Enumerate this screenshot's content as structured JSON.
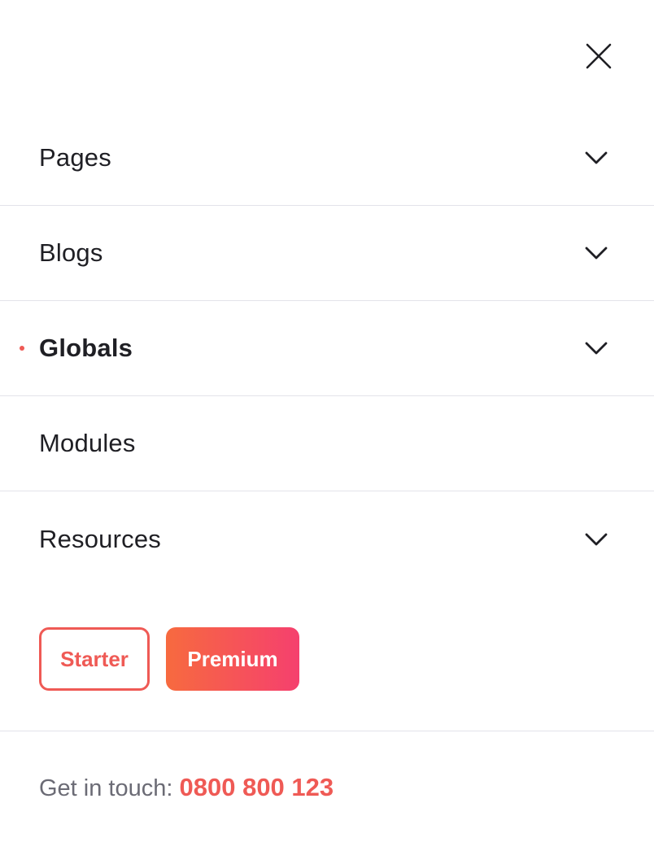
{
  "nav": {
    "items": [
      {
        "label": "Pages",
        "has_dropdown": true,
        "active": false
      },
      {
        "label": "Blogs",
        "has_dropdown": true,
        "active": false
      },
      {
        "label": "Globals",
        "has_dropdown": true,
        "active": true
      },
      {
        "label": "Modules",
        "has_dropdown": false,
        "active": false
      },
      {
        "label": "Resources",
        "has_dropdown": true,
        "active": false
      }
    ]
  },
  "buttons": {
    "starter_label": "Starter",
    "premium_label": "Premium"
  },
  "contact": {
    "prefix": "Get in touch: ",
    "phone": "0800 800 123"
  },
  "icons": {
    "close": "close-icon",
    "dropdown": "chevron-down-icon"
  },
  "colors": {
    "accent": "#ef5a55",
    "gradient_start": "#f76a3f",
    "gradient_end": "#f5406e",
    "text": "#1f1f24",
    "muted": "#6b6b75",
    "divider": "#e3e3ea"
  }
}
